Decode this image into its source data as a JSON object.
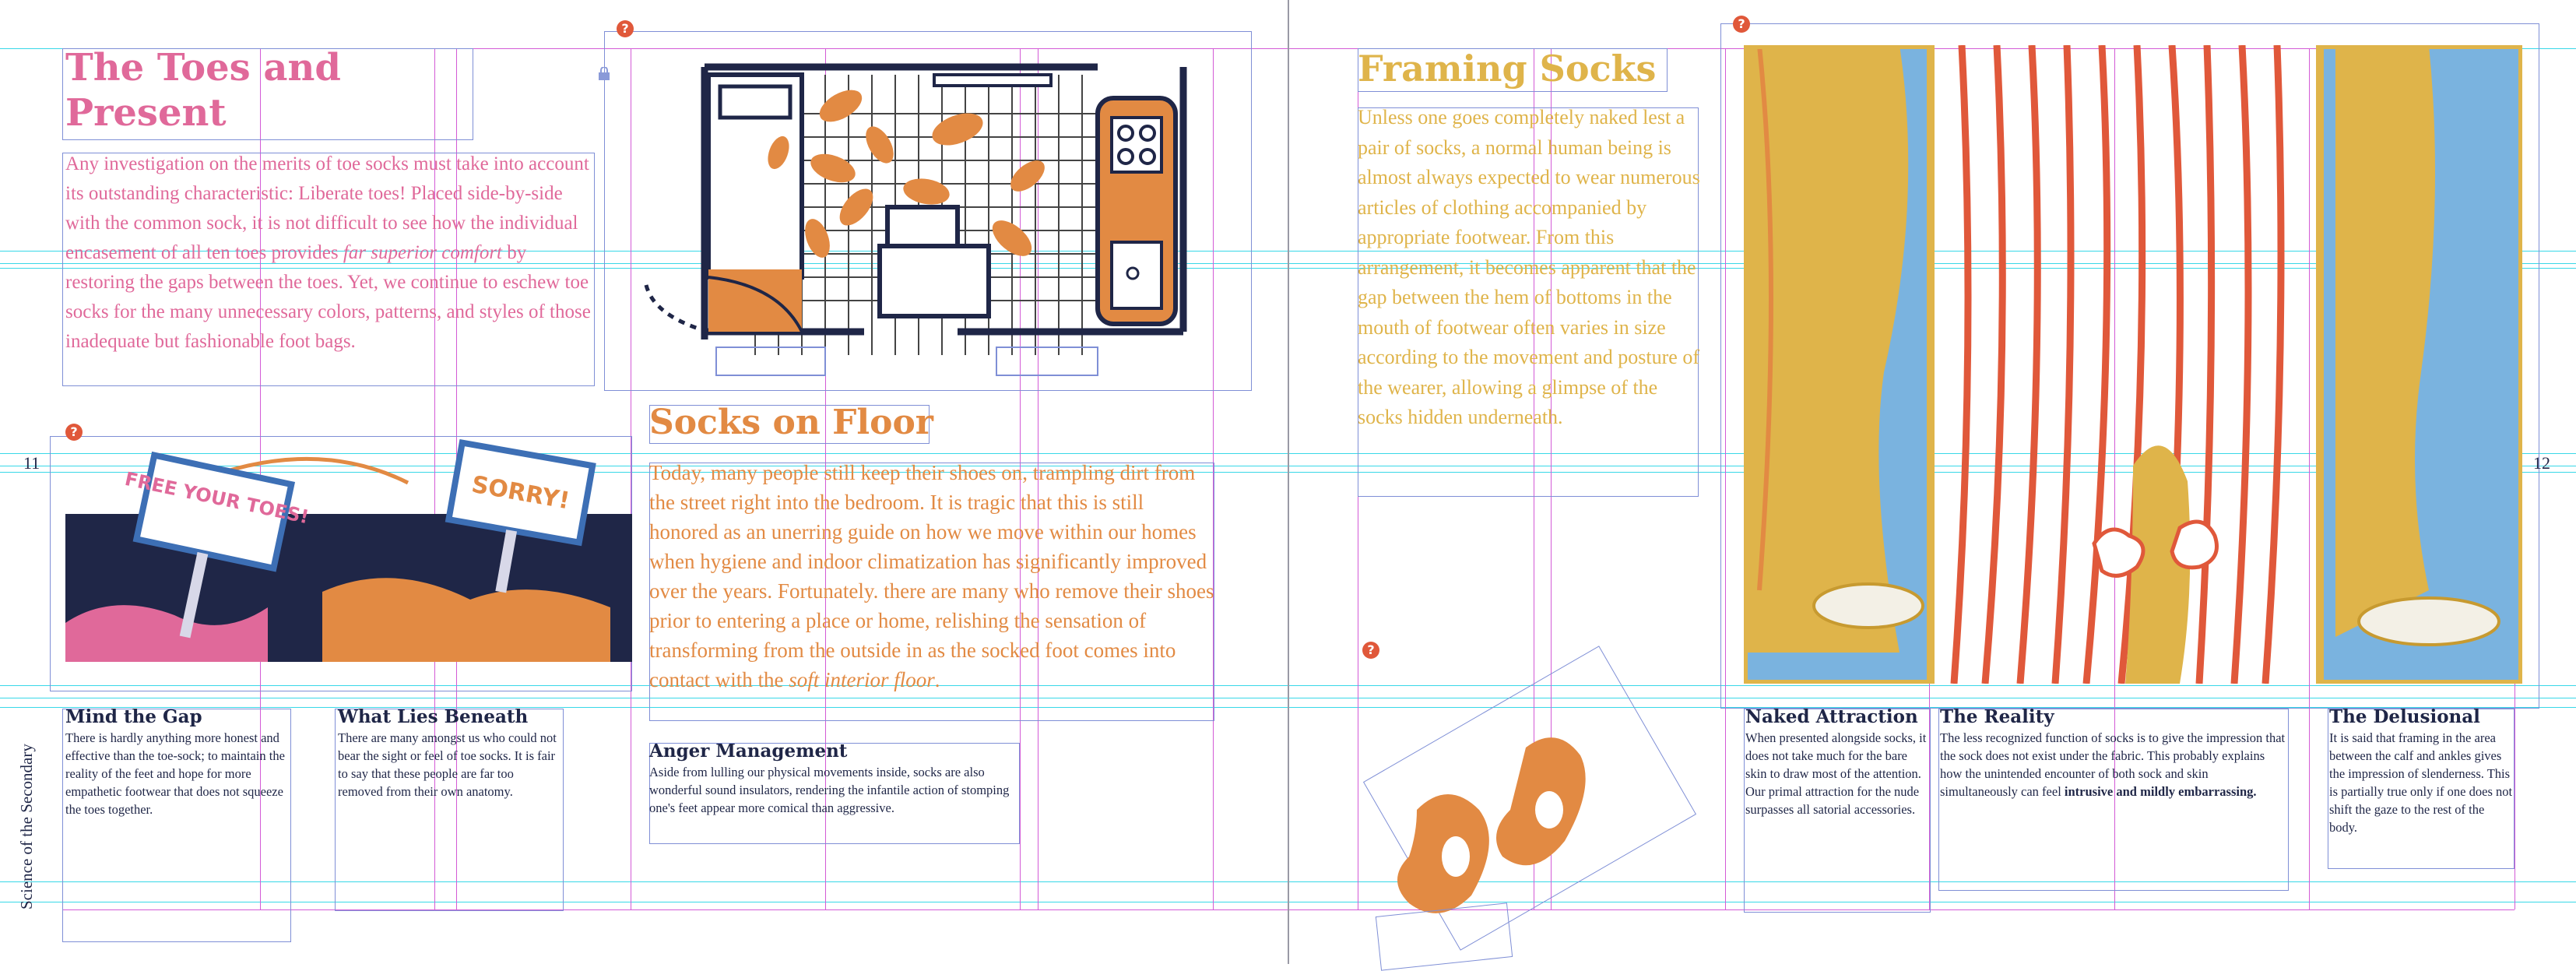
{
  "colors": {
    "pink": "#e0699a",
    "orange": "#e28a43",
    "yellow": "#dfb44a",
    "navy": "#1f2647",
    "blue": "#7ab3df",
    "guide_cyan": "#38d8e8",
    "guide_magenta": "#d35bd6",
    "frame": "#7f8fd6",
    "marker": "#e0583a"
  },
  "left_page": {
    "page_number": "11",
    "running_head": "Science of the Secondary",
    "toes_article": {
      "title_line1": "The Toes and",
      "title_line2": "Present",
      "body_before_em": "Any investigation on the merits of toe socks must take into account its outstanding characteristic: Liberate toes! Placed side-by-side with the common sock, it is not difficult to see how the individual encasement of all ten toes provides ",
      "body_em": "far superior comfort",
      "body_after_em": " by restoring the gaps between the toes. Yet, we continue to eschew toe socks for the many unnecessary colors, patterns, and styles of those inadequate but fashionable foot bags."
    },
    "protest_illustration": {
      "sign_left": "FREE YOUR TOES!",
      "sign_right": "SORRY!"
    },
    "floor_article": {
      "title": "Socks on Floor",
      "body_before_em": "Today, many people still keep their shoes on, trampling dirt from the street right into the bedroom. It is tragic that this is still honored as an unerring guide on how we move within our homes when hygiene and indoor climatization has significantly improved over the years. Fortunately. there are many who remove their shoes prior to entering a place or home, relishing the sensation of transforming from the outside in as the socked foot comes into contact with the ",
      "body_em": "soft interior floor",
      "body_after_em": "."
    },
    "captions": [
      {
        "title": "Mind the Gap",
        "body": "There is hardly anything more honest and effective than the toe-sock; to maintain the reality of the feet and hope for more empathetic footwear that does not squeeze the toes together."
      },
      {
        "title": "What Lies Beneath",
        "body": "There are many amongst us who could not bear the sight or feel of toe socks. It is fair to say that these people are far too removed from their own anatomy."
      },
      {
        "title": "Anger Management",
        "body": "Aside from lulling our physical movements inside, socks are also wonderful sound insulators, rendering the infantile action of stomping one's feet appear more comical than aggressive."
      }
    ]
  },
  "right_page": {
    "page_number": "12",
    "framing_article": {
      "title": "Framing Socks",
      "body": "Unless one goes completely naked lest a pair of socks, a normal human being is almost always expected to wear numerous articles of clothing accompanied by appropriate footwear. From this arrangement, it becomes apparent that the gap between the hem of bottoms in the mouth of footwear often varies in size according to the movement and posture of the wearer, allowing a glimpse of the socks hidden underneath."
    },
    "captions": [
      {
        "title": "Naked Attraction",
        "body": "When presented alongside socks, it does not take much for the bare skin to draw most of the attention. Our primal attraction for the nude surpasses all satorial accessories."
      },
      {
        "title": "The Reality",
        "body_before_strong": "The less recognized function of socks is to give the impression that the sock does not exist under the fabric. This probably explains how the unintended encounter of both sock and skin simultaneously can feel ",
        "body_strong": "intrusive and mildly embarrassing."
      },
      {
        "title": "The Delusional",
        "body": "It is said that framing in the area between the calf and ankles gives the impression of slenderness. This is partially true only if one does not shift the gaze to the rest of the body."
      }
    ]
  },
  "markers": {
    "symbol": "?"
  }
}
